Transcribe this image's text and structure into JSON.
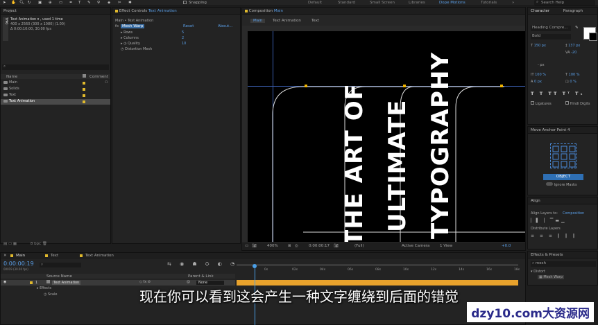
{
  "topbar": {
    "snapping": "Snapping",
    "workspaces": [
      "Default",
      "Standard",
      "Small Screen",
      "Libraries",
      "Dope Motions",
      "Tutorials"
    ],
    "search": "Search Help"
  },
  "project": {
    "title": "Project",
    "comp_name": "Text Animation",
    "used": "▾ , used 1 time",
    "size": "400 x 2560 (300 x 1080) (1.00)",
    "duration": "Δ 0:00:10:00, 30.00 fps",
    "columns": [
      "Name",
      "Comment"
    ],
    "items": [
      "Main",
      "Solids",
      "Text",
      "Text Animation"
    ],
    "bpc": "8 bpc"
  },
  "effect_controls": {
    "title": "Effect Controls",
    "comp": "Text Animation",
    "breadcrumb": "Main • Text Animation",
    "effect": "Mesh Warp",
    "reset": "Reset",
    "about": "About...",
    "params": [
      {
        "label": "Rows",
        "value": "5"
      },
      {
        "label": "Columns",
        "value": "2"
      },
      {
        "label": "Quality",
        "value": "10"
      },
      {
        "label": "Distortion Mesh",
        "value": ""
      }
    ]
  },
  "composition": {
    "title": "Composition",
    "comp": "Main",
    "tabs": [
      "Main",
      "Text Animation",
      "Text"
    ],
    "text_lines": [
      "THE ART OF",
      "ULTIMATE",
      "TYPOGRAPHY"
    ],
    "zoom": "400%",
    "time": "0:00:00:17",
    "quality": "(Full)",
    "camera": "Active Camera",
    "view": "1 View",
    "exposure": "+0.0"
  },
  "character": {
    "tabs": [
      "Character",
      "Paragraph"
    ],
    "font": "Heading Compre...",
    "style": "Bold",
    "size": "150 px",
    "leading": "137 px",
    "tracking_label": "VA",
    "tracking": "-20",
    "vscale": "100 %",
    "hscale": "100 %",
    "baseline": "0 px",
    "tsume": "0 %",
    "px_unit": "- px",
    "ligatures": "Ligatures",
    "hindi": "Hindi Digits"
  },
  "move_anchor": {
    "title": "Move Anchor Point 4",
    "button": "OBJECT",
    "ignore": "Ignore Masks"
  },
  "align": {
    "title": "Align",
    "align_to_label": "Align Layers to:",
    "align_to": "Composition",
    "distribute": "Distribute Layers"
  },
  "effects_presets": {
    "title": "Effects & Presets",
    "search": "mesh",
    "category": "Distort",
    "item": "Mesh Warp"
  },
  "timeline": {
    "tabs": [
      "Main",
      "Text",
      "Text Animation"
    ],
    "timecode": "0:00:00:19",
    "fps": "00019 (30.00 fps)",
    "columns": [
      "Source Name",
      "Parent & Link"
    ],
    "layer_num": "1",
    "layer_name": "Text Animation",
    "parent": "None",
    "props": [
      "Effects",
      "Scale"
    ],
    "ticks": [
      "0s",
      "02s",
      "04s",
      "06s",
      "08s",
      "10s",
      "12s",
      "14s",
      "16s",
      "18s"
    ]
  },
  "subtitle": "现在你可以看到这会产生一种文字缠绕到后面的错觉",
  "watermark": "dzy10.com大资源网",
  "colors": {
    "accent": "#5a9fe8",
    "label_yellow": "#e0b92c",
    "bar_orange": "#e8a22c",
    "bg": "#1d1d1d"
  }
}
